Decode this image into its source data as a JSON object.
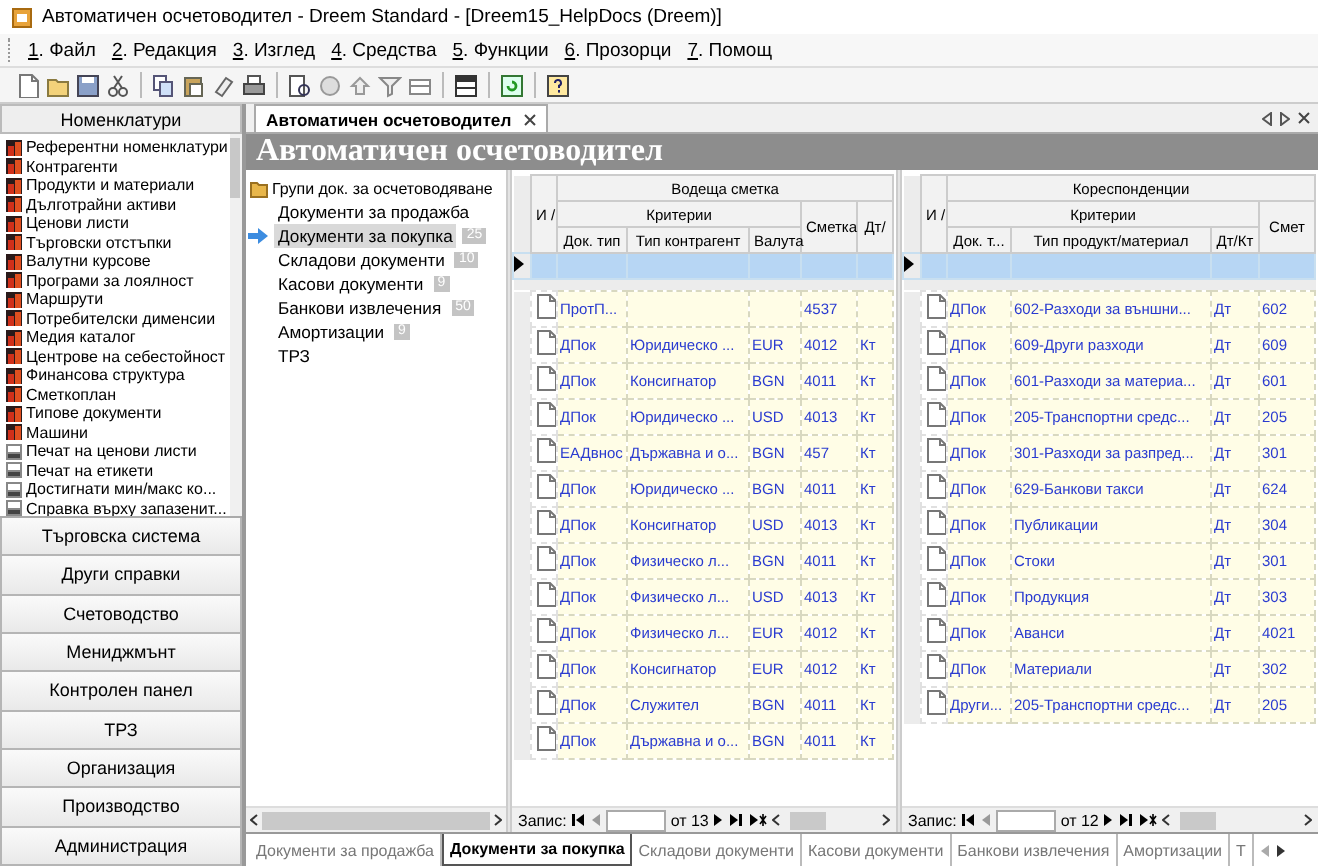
{
  "window": {
    "title": "Автоматичен осчетоводител - Dreem Standard - [Dreem15_HelpDocs (Dreem)]"
  },
  "menu": [
    "1. Файл",
    "2. Редакция",
    "3. Изглед",
    "4. Средства",
    "5. Функции",
    "6. Прозорци",
    "7. Помощ"
  ],
  "sidebar": {
    "header": "Номенклатури",
    "items": [
      {
        "label": "Референтни номенклатури",
        "kind": "module"
      },
      {
        "label": "Контрагенти",
        "kind": "module"
      },
      {
        "label": "Продукти и материали",
        "kind": "module"
      },
      {
        "label": "Дълготрайни активи",
        "kind": "module"
      },
      {
        "label": "Ценови листи",
        "kind": "module"
      },
      {
        "label": "Търговски отстъпки",
        "kind": "module"
      },
      {
        "label": "Валутни курсове",
        "kind": "module"
      },
      {
        "label": "Програми за лоялност",
        "kind": "module"
      },
      {
        "label": "Маршрути",
        "kind": "module"
      },
      {
        "label": "Потребителски дименсии",
        "kind": "module"
      },
      {
        "label": "Медия каталог",
        "kind": "module"
      },
      {
        "label": "Центрове на себестойност",
        "kind": "module"
      },
      {
        "label": "Финансова структура",
        "kind": "module"
      },
      {
        "label": "Сметкоплан",
        "kind": "module"
      },
      {
        "label": "Типове документи",
        "kind": "module"
      },
      {
        "label": "Машини",
        "kind": "module"
      },
      {
        "label": "Печат на ценови листи",
        "kind": "report"
      },
      {
        "label": "Печат на етикети",
        "kind": "report"
      },
      {
        "label": "Достигнати мин/макс ко...",
        "kind": "report"
      },
      {
        "label": "Справка върху запазенит...",
        "kind": "report"
      }
    ],
    "sections": [
      "Търговска система",
      "Други справки",
      "Счетоводство",
      "Мениджмънт",
      "Контролен панел",
      "ТРЗ",
      "Организация",
      "Производство",
      "Администрация"
    ]
  },
  "document_tabs": [
    {
      "label": "Автоматичен осчетоводител",
      "selected": true
    }
  ],
  "page_title": "Автоматичен осчетоводител",
  "tree": {
    "root": "Групи док. за осчетоводяване",
    "children": [
      {
        "label": "Документи за продажба",
        "selected": false
      },
      {
        "label": "Документи за покупка",
        "count": "25",
        "selected": true
      },
      {
        "label": "Складови документи",
        "count": "10",
        "selected": false
      },
      {
        "label": "Касови документи",
        "count": "9",
        "selected": false
      },
      {
        "label": "Банкови извлечения",
        "count": "50",
        "selected": false
      },
      {
        "label": "Амортизации",
        "count": "9",
        "selected": false
      },
      {
        "label": "ТРЗ",
        "selected": false
      }
    ]
  },
  "grids": [
    {
      "group": "Водеща сметка",
      "subgroup": "Критерии",
      "icon_column": "И /",
      "columns": [
        {
          "label": "Док. тип",
          "kind": "criteria"
        },
        {
          "label": "Тип контрагент",
          "kind": "criteria"
        },
        {
          "label": "Валута",
          "kind": "criteria"
        },
        {
          "label": "Сметка",
          "kind": "plain"
        },
        {
          "label": "Дт/",
          "kind": "plain"
        }
      ],
      "rows": [
        [
          "ПротП...",
          "",
          "",
          "4537",
          ""
        ],
        [
          "ДПок",
          "Юридическо ...",
          "EUR",
          "4012",
          "Кт"
        ],
        [
          "ДПок",
          "Консигнатор",
          "BGN",
          "4011",
          "Кт"
        ],
        [
          "ДПок",
          "Юридическо ...",
          "USD",
          "4013",
          "Кт"
        ],
        [
          "ЕАДвнос",
          "Държавна и о...",
          "BGN",
          "457",
          "Кт"
        ],
        [
          "ДПок",
          "Юридическо ...",
          "BGN",
          "4011",
          "Кт"
        ],
        [
          "ДПок",
          "Консигнатор",
          "USD",
          "4013",
          "Кт"
        ],
        [
          "ДПок",
          "Физическо л...",
          "BGN",
          "4011",
          "Кт"
        ],
        [
          "ДПок",
          "Физическо л...",
          "USD",
          "4013",
          "Кт"
        ],
        [
          "ДПок",
          "Физическо л...",
          "EUR",
          "4012",
          "Кт"
        ],
        [
          "ДПок",
          "Консигнатор",
          "EUR",
          "4012",
          "Кт"
        ],
        [
          "ДПок",
          "Служител",
          "BGN",
          "4011",
          "Кт"
        ],
        [
          "ДПок",
          "Държавна и о...",
          "BGN",
          "4011",
          "Кт"
        ]
      ],
      "navigator": {
        "label": "Запис:",
        "total": "от 13"
      }
    },
    {
      "group": "Кореспонденции",
      "subgroup": "Критерии",
      "icon_column": "И /",
      "columns": [
        {
          "label": "Док. т...",
          "kind": "criteria"
        },
        {
          "label": "Тип продукт/материал",
          "kind": "criteria"
        },
        {
          "label": "Дт/Кт",
          "kind": "criteria"
        },
        {
          "label": "Смет",
          "kind": "plain"
        }
      ],
      "rows": [
        [
          "ДПок",
          "602-Разходи за външни...",
          "Дт",
          "602"
        ],
        [
          "ДПок",
          "609-Други разходи",
          "Дт",
          "609"
        ],
        [
          "ДПок",
          "601-Разходи за материа...",
          "Дт",
          "601"
        ],
        [
          "ДПок",
          "205-Транспортни средс...",
          "Дт",
          "205"
        ],
        [
          "ДПок",
          "301-Разходи за разпред...",
          "Дт",
          "301"
        ],
        [
          "ДПок",
          "629-Банкови такси",
          "Дт",
          "624"
        ],
        [
          "ДПок",
          "Публикации",
          "Дт",
          "304"
        ],
        [
          "ДПок",
          "Стоки",
          "Дт",
          "301"
        ],
        [
          "ДПок",
          "Продукция",
          "Дт",
          "303"
        ],
        [
          "ДПок",
          "Аванси",
          "Дт",
          "4021"
        ],
        [
          "ДПок",
          "Материали",
          "Дт",
          "302"
        ],
        [
          "Други...",
          "205-Транспортни средс...",
          "Дт",
          "205"
        ]
      ],
      "navigator": {
        "label": "Запис:",
        "total": "от 12"
      }
    }
  ],
  "bottom_tabs": [
    {
      "label": "Документи за продажба",
      "selected": false
    },
    {
      "label": "Документи за покупка",
      "selected": true
    },
    {
      "label": "Складови документи",
      "selected": false
    },
    {
      "label": "Касови документи",
      "selected": false
    },
    {
      "label": "Банкови извлечения",
      "selected": false
    },
    {
      "label": "Амортизации",
      "selected": false
    },
    {
      "label": "Т",
      "selected": false
    }
  ]
}
